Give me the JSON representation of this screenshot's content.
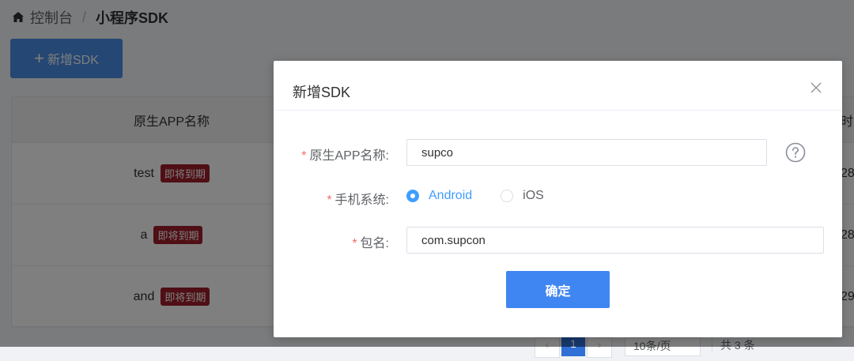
{
  "breadcrumb": {
    "home": "控制台",
    "separator": "/",
    "current": "小程序SDK"
  },
  "toolbar": {
    "add_label": "新增SDK"
  },
  "table": {
    "header_name": "原生APP名称",
    "header_right_partial": "时",
    "rows": [
      {
        "name": "test",
        "badge": "即将到期",
        "right_partial": "28"
      },
      {
        "name": "a",
        "badge": "即将到期",
        "right_partial": "28"
      },
      {
        "name": "and",
        "badge": "即将到期",
        "right_partial": "29"
      }
    ]
  },
  "pagination": {
    "current_page": "1",
    "page_size": "10条/页",
    "total": "共 3 条"
  },
  "dialog": {
    "title": "新增SDK",
    "fields": {
      "app_name": {
        "label": "原生APP名称:",
        "value": "supco"
      },
      "os": {
        "label": "手机系统:",
        "options": [
          "Android",
          "iOS"
        ],
        "selected": "Android"
      },
      "package": {
        "label": "包名:",
        "value": "com.supcon"
      }
    },
    "required_mark": "*",
    "confirm_label": "确定"
  },
  "colors": {
    "primary": "#409eff",
    "badge": "#9e1f2a",
    "required": "#f56c6c"
  }
}
